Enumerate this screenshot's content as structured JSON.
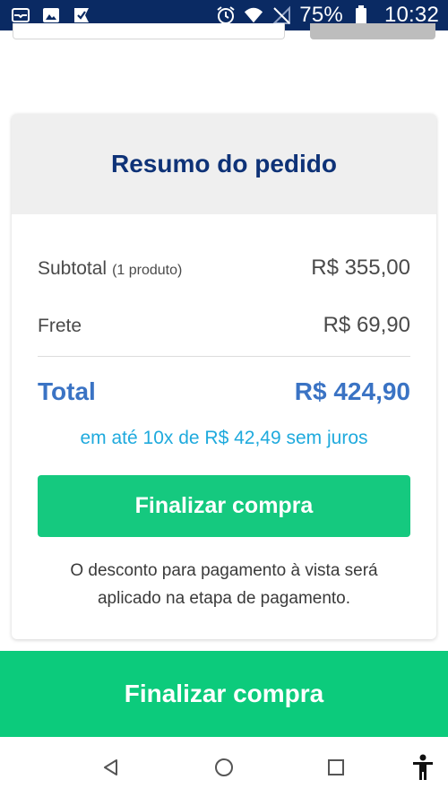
{
  "status_bar": {
    "left_icons": [
      "mail-icon",
      "image-icon",
      "check-flag-icon"
    ],
    "right_icons": [
      "alarm-icon",
      "wifi-icon",
      "no-signal-icon",
      "battery-icon"
    ],
    "battery": "75%",
    "time": "10:32"
  },
  "summary": {
    "title": "Resumo do pedido",
    "subtotal_label": "Subtotal",
    "subtotal_qty": "(1 produto)",
    "subtotal_value": "R$ 355,00",
    "shipping_label": "Frete",
    "shipping_value": "R$ 69,90",
    "total_label": "Total",
    "total_value": "R$ 424,90",
    "installments": "em até 10x de R$ 42,49 sem juros",
    "button_label": "Finalizar compra",
    "discount_note": "O desconto para pagamento à vista será aplicado na etapa de pagamento."
  },
  "bottom_bar": {
    "button_label": "Finalizar compra"
  },
  "nav_bar": {
    "buttons": [
      "back-icon",
      "home-icon",
      "recents-icon",
      "accessibility-icon"
    ]
  },
  "colors": {
    "status_bar": "#0a2a63",
    "title": "#0e3277",
    "total": "#3a73c4",
    "installments": "#1faadd",
    "primary_button": "#15c97f"
  }
}
